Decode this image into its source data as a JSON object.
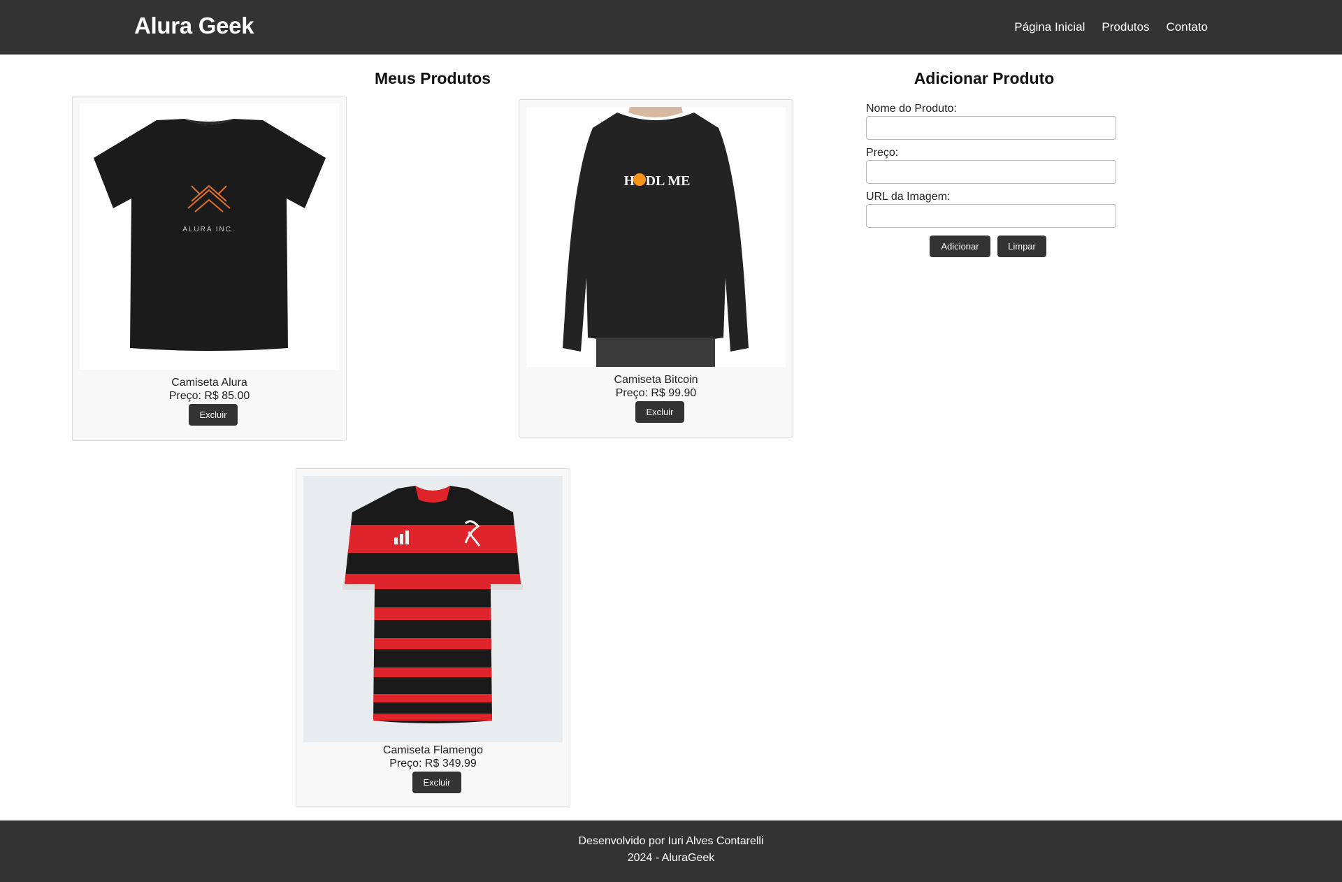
{
  "header": {
    "brand": "Alura Geek",
    "nav": [
      "Página Inicial",
      "Produtos",
      "Contato"
    ]
  },
  "products_section": {
    "title": "Meus Produtos",
    "items": [
      {
        "name": "Camiseta Alura",
        "price": "Preço: R$ 85.00",
        "delete_label": "Excluir",
        "image": "black-tshirt-alura-inc",
        "shirt_text": "ALURA INC."
      },
      {
        "name": "Camiseta Bitcoin",
        "price": "Preço: R$ 99.90",
        "delete_label": "Excluir",
        "image": "black-longsleeve-hodl-me",
        "shirt_text": "HODL ME"
      },
      {
        "name": "Camiseta Flamengo",
        "price": "Preço: R$ 349.99",
        "delete_label": "Excluir",
        "image": "flamengo-red-black-striped-jersey"
      }
    ]
  },
  "form": {
    "title": "Adicionar Produto",
    "name_label": "Nome do Produto:",
    "price_label": "Preço:",
    "url_label": "URL da Imagem:",
    "name_value": "",
    "price_value": "",
    "url_value": "",
    "add_label": "Adicionar",
    "clear_label": "Limpar"
  },
  "footer": {
    "line1": "Desenvolvido por Iuri Alves Contarelli",
    "line2": "2024 - AluraGeek"
  },
  "colors": {
    "header_bg": "#333333",
    "button_bg": "#333333",
    "card_bg": "#f8f8f8",
    "flamengo_red": "#e0242c",
    "bitcoin_orange": "#f7931a"
  }
}
